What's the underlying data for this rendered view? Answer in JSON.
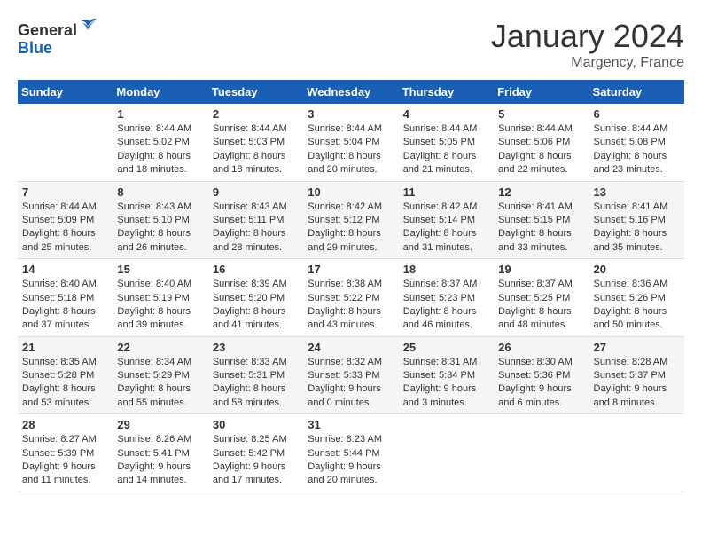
{
  "header": {
    "logo_line1": "General",
    "logo_line2": "Blue",
    "title": "January 2024",
    "subtitle": "Margency, France"
  },
  "weekdays": [
    "Sunday",
    "Monday",
    "Tuesday",
    "Wednesday",
    "Thursday",
    "Friday",
    "Saturday"
  ],
  "weeks": [
    [
      {
        "day": "",
        "info": ""
      },
      {
        "day": "1",
        "info": "Sunrise: 8:44 AM\nSunset: 5:02 PM\nDaylight: 8 hours\nand 18 minutes."
      },
      {
        "day": "2",
        "info": "Sunrise: 8:44 AM\nSunset: 5:03 PM\nDaylight: 8 hours\nand 18 minutes."
      },
      {
        "day": "3",
        "info": "Sunrise: 8:44 AM\nSunset: 5:04 PM\nDaylight: 8 hours\nand 20 minutes."
      },
      {
        "day": "4",
        "info": "Sunrise: 8:44 AM\nSunset: 5:05 PM\nDaylight: 8 hours\nand 21 minutes."
      },
      {
        "day": "5",
        "info": "Sunrise: 8:44 AM\nSunset: 5:06 PM\nDaylight: 8 hours\nand 22 minutes."
      },
      {
        "day": "6",
        "info": "Sunrise: 8:44 AM\nSunset: 5:08 PM\nDaylight: 8 hours\nand 23 minutes."
      }
    ],
    [
      {
        "day": "7",
        "info": "Sunrise: 8:44 AM\nSunset: 5:09 PM\nDaylight: 8 hours\nand 25 minutes."
      },
      {
        "day": "8",
        "info": "Sunrise: 8:43 AM\nSunset: 5:10 PM\nDaylight: 8 hours\nand 26 minutes."
      },
      {
        "day": "9",
        "info": "Sunrise: 8:43 AM\nSunset: 5:11 PM\nDaylight: 8 hours\nand 28 minutes."
      },
      {
        "day": "10",
        "info": "Sunrise: 8:42 AM\nSunset: 5:12 PM\nDaylight: 8 hours\nand 29 minutes."
      },
      {
        "day": "11",
        "info": "Sunrise: 8:42 AM\nSunset: 5:14 PM\nDaylight: 8 hours\nand 31 minutes."
      },
      {
        "day": "12",
        "info": "Sunrise: 8:41 AM\nSunset: 5:15 PM\nDaylight: 8 hours\nand 33 minutes."
      },
      {
        "day": "13",
        "info": "Sunrise: 8:41 AM\nSunset: 5:16 PM\nDaylight: 8 hours\nand 35 minutes."
      }
    ],
    [
      {
        "day": "14",
        "info": "Sunrise: 8:40 AM\nSunset: 5:18 PM\nDaylight: 8 hours\nand 37 minutes."
      },
      {
        "day": "15",
        "info": "Sunrise: 8:40 AM\nSunset: 5:19 PM\nDaylight: 8 hours\nand 39 minutes."
      },
      {
        "day": "16",
        "info": "Sunrise: 8:39 AM\nSunset: 5:20 PM\nDaylight: 8 hours\nand 41 minutes."
      },
      {
        "day": "17",
        "info": "Sunrise: 8:38 AM\nSunset: 5:22 PM\nDaylight: 8 hours\nand 43 minutes."
      },
      {
        "day": "18",
        "info": "Sunrise: 8:37 AM\nSunset: 5:23 PM\nDaylight: 8 hours\nand 46 minutes."
      },
      {
        "day": "19",
        "info": "Sunrise: 8:37 AM\nSunset: 5:25 PM\nDaylight: 8 hours\nand 48 minutes."
      },
      {
        "day": "20",
        "info": "Sunrise: 8:36 AM\nSunset: 5:26 PM\nDaylight: 8 hours\nand 50 minutes."
      }
    ],
    [
      {
        "day": "21",
        "info": "Sunrise: 8:35 AM\nSunset: 5:28 PM\nDaylight: 8 hours\nand 53 minutes."
      },
      {
        "day": "22",
        "info": "Sunrise: 8:34 AM\nSunset: 5:29 PM\nDaylight: 8 hours\nand 55 minutes."
      },
      {
        "day": "23",
        "info": "Sunrise: 8:33 AM\nSunset: 5:31 PM\nDaylight: 8 hours\nand 58 minutes."
      },
      {
        "day": "24",
        "info": "Sunrise: 8:32 AM\nSunset: 5:33 PM\nDaylight: 9 hours\nand 0 minutes."
      },
      {
        "day": "25",
        "info": "Sunrise: 8:31 AM\nSunset: 5:34 PM\nDaylight: 9 hours\nand 3 minutes."
      },
      {
        "day": "26",
        "info": "Sunrise: 8:30 AM\nSunset: 5:36 PM\nDaylight: 9 hours\nand 6 minutes."
      },
      {
        "day": "27",
        "info": "Sunrise: 8:28 AM\nSunset: 5:37 PM\nDaylight: 9 hours\nand 8 minutes."
      }
    ],
    [
      {
        "day": "28",
        "info": "Sunrise: 8:27 AM\nSunset: 5:39 PM\nDaylight: 9 hours\nand 11 minutes."
      },
      {
        "day": "29",
        "info": "Sunrise: 8:26 AM\nSunset: 5:41 PM\nDaylight: 9 hours\nand 14 minutes."
      },
      {
        "day": "30",
        "info": "Sunrise: 8:25 AM\nSunset: 5:42 PM\nDaylight: 9 hours\nand 17 minutes."
      },
      {
        "day": "31",
        "info": "Sunrise: 8:23 AM\nSunset: 5:44 PM\nDaylight: 9 hours\nand 20 minutes."
      },
      {
        "day": "",
        "info": ""
      },
      {
        "day": "",
        "info": ""
      },
      {
        "day": "",
        "info": ""
      }
    ]
  ]
}
